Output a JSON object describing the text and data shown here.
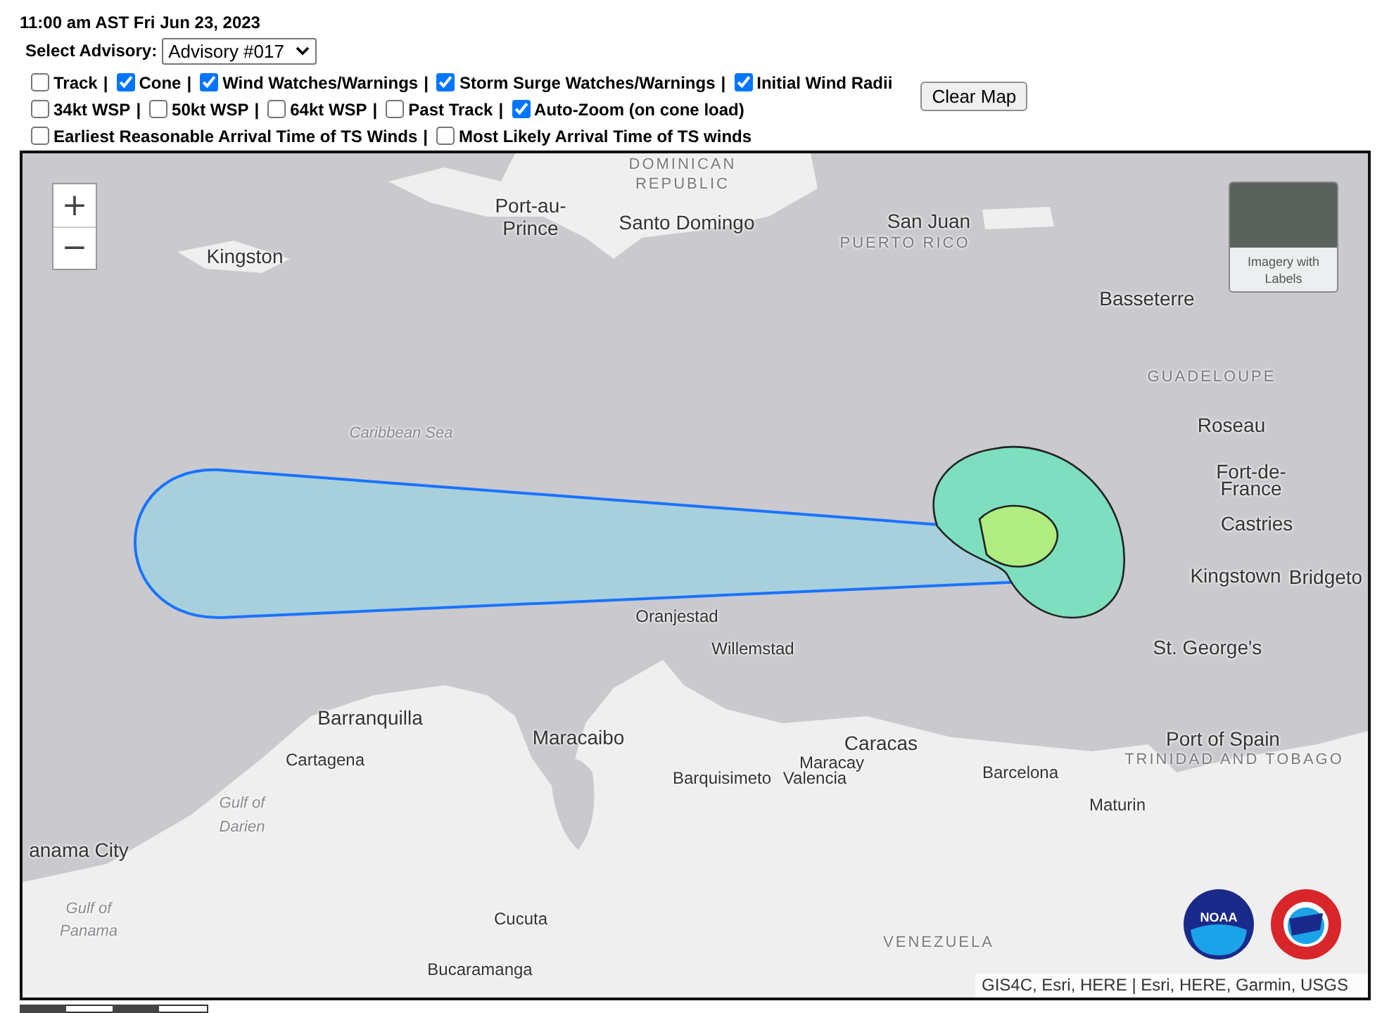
{
  "header": {
    "datetime": "11:00 am AST Fri Jun 23, 2023"
  },
  "advisory": {
    "label": "Select Advisory:",
    "value": "Advisory #017"
  },
  "layer_rows": [
    [
      {
        "kind": "checkbox",
        "label": "Track",
        "checked": false
      },
      {
        "kind": "separator",
        "text": "|"
      },
      {
        "kind": "checkbox",
        "label": "Cone",
        "checked": true
      },
      {
        "kind": "separator",
        "text": "|"
      },
      {
        "kind": "checkbox",
        "label": "Wind Watches/Warnings",
        "checked": true
      },
      {
        "kind": "separator",
        "text": "|"
      },
      {
        "kind": "checkbox",
        "label": "Storm Surge Watches/Warnings",
        "checked": true
      },
      {
        "kind": "separator",
        "text": "|"
      },
      {
        "kind": "checkbox",
        "label": "Initial Wind Radii",
        "checked": true
      }
    ],
    [
      {
        "kind": "checkbox",
        "label": "34kt WSP",
        "checked": false
      },
      {
        "kind": "separator",
        "text": "|"
      },
      {
        "kind": "checkbox",
        "label": "50kt WSP",
        "checked": false
      },
      {
        "kind": "separator",
        "text": "|"
      },
      {
        "kind": "checkbox",
        "label": "64kt WSP",
        "checked": false
      },
      {
        "kind": "separator",
        "text": "|"
      },
      {
        "kind": "checkbox",
        "label": "Past Track",
        "checked": false
      },
      {
        "kind": "separator",
        "text": "|"
      },
      {
        "kind": "checkbox",
        "label": "Auto-Zoom (on cone load)",
        "checked": true
      }
    ],
    [
      {
        "kind": "checkbox",
        "label": "Earliest Reasonable Arrival Time of TS Winds",
        "checked": false
      },
      {
        "kind": "separator",
        "text": "|"
      },
      {
        "kind": "checkbox",
        "label": "Most Likely Arrival Time of TS winds",
        "checked": false
      }
    ]
  ],
  "clear_button": "Clear Map",
  "map": {
    "zoom_in": "+",
    "zoom_out": "−",
    "basemap_label": "Imagery with Labels",
    "places": [
      {
        "kind": "country",
        "text": "DOMINICAN"
      },
      {
        "kind": "country",
        "text": "REPUBLIC"
      },
      {
        "kind": "city",
        "text": "Port-au-"
      },
      {
        "kind": "city",
        "text": "Prince"
      },
      {
        "kind": "city",
        "text": "Santo Domingo"
      },
      {
        "kind": "city",
        "text": "San Juan"
      },
      {
        "kind": "country",
        "text": "PUERTO RICO"
      },
      {
        "kind": "city",
        "text": "Kingston"
      },
      {
        "kind": "city",
        "text": "Basseterre"
      },
      {
        "kind": "country",
        "text": "GUADELOUPE"
      },
      {
        "kind": "city",
        "text": "Roseau"
      },
      {
        "kind": "water",
        "text": "Caribbean Sea"
      },
      {
        "kind": "city",
        "text": "Fort-de-"
      },
      {
        "kind": "city",
        "text": "France"
      },
      {
        "kind": "city",
        "text": "Castries"
      },
      {
        "kind": "city",
        "text": "Kingstown"
      },
      {
        "kind": "city",
        "text": "Bridgeto"
      },
      {
        "kind": "town",
        "text": "Oranjestad"
      },
      {
        "kind": "town",
        "text": "Willemstad"
      },
      {
        "kind": "city",
        "text": "St. George's"
      },
      {
        "kind": "city",
        "text": "Barranquilla"
      },
      {
        "kind": "city",
        "text": "Maracaibo"
      },
      {
        "kind": "city",
        "text": "Caracas"
      },
      {
        "kind": "city",
        "text": "Port of Spain"
      },
      {
        "kind": "town",
        "text": "Cartagena"
      },
      {
        "kind": "town",
        "text": "Maracay"
      },
      {
        "kind": "country",
        "text": "TRINIDAD AND TOBAGO"
      },
      {
        "kind": "town",
        "text": "Barquisimeto"
      },
      {
        "kind": "town",
        "text": "Valencia"
      },
      {
        "kind": "town",
        "text": "Barcelona"
      },
      {
        "kind": "water",
        "text": "Gulf of"
      },
      {
        "kind": "water",
        "text": "Darien"
      },
      {
        "kind": "town",
        "text": "Maturin"
      },
      {
        "kind": "city",
        "text": "anama City"
      },
      {
        "kind": "water",
        "text": "Gulf of"
      },
      {
        "kind": "water",
        "text": "Panama"
      },
      {
        "kind": "town",
        "text": "Cucuta"
      },
      {
        "kind": "country",
        "text": "VENEZUELA"
      },
      {
        "kind": "town",
        "text": "Bucaramanga"
      }
    ],
    "logo_text": "NOAA",
    "attribution": "GIS4C, Esri, HERE | Esri, HERE, Garmin, USGS"
  }
}
